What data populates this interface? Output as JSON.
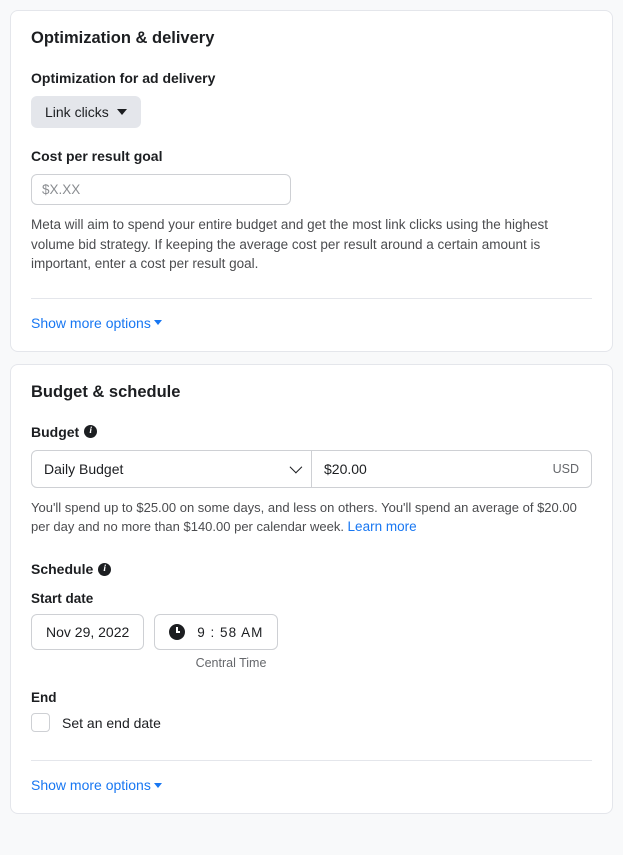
{
  "optimization": {
    "title": "Optimization & delivery",
    "ad_delivery_label": "Optimization for ad delivery",
    "ad_delivery_value": "Link clicks",
    "cost_goal_label": "Cost per result goal",
    "cost_goal_placeholder": "$X.XX",
    "cost_goal_help": "Meta will aim to spend your entire budget and get the most link clicks using the highest volume bid strategy. If keeping the average cost per result around a certain amount is important, enter a cost per result goal.",
    "show_more": "Show more options"
  },
  "budget": {
    "title": "Budget & schedule",
    "budget_label": "Budget",
    "budget_type": "Daily Budget",
    "budget_amount": "$20.00",
    "budget_currency": "USD",
    "budget_help": "You'll spend up to $25.00 on some days, and less on others. You'll spend an average of $20.00 per day and no more than $140.00 per calendar week. ",
    "learn_more": "Learn more",
    "schedule_label": "Schedule",
    "start_date_label": "Start date",
    "start_date_value": "Nov 29, 2022",
    "start_time_value": "9 : 58 AM",
    "timezone": "Central Time",
    "end_label": "End",
    "end_checkbox_label": "Set an end date",
    "show_more": "Show more options"
  }
}
